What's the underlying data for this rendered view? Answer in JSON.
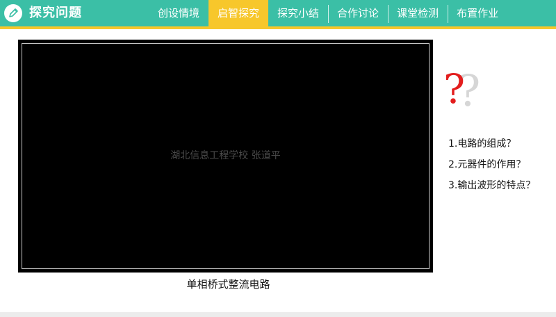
{
  "header": {
    "title": "探究问题",
    "logo_icon": "pencil-icon",
    "bg_color": "#3bbfa6",
    "accent_color": "#f7c72b"
  },
  "nav": {
    "items": [
      {
        "label": "创设情境",
        "active": false
      },
      {
        "label": "启智探究",
        "active": true
      },
      {
        "label": "探究小结",
        "active": false
      },
      {
        "label": "合作讨论",
        "active": false
      },
      {
        "label": "课堂检测",
        "active": false
      },
      {
        "label": "布置作业",
        "active": false
      }
    ]
  },
  "video": {
    "watermark": "湖北信息工程学校  张道平",
    "caption": "单相桥式整流电路"
  },
  "questions": {
    "icon": "question-mark-icon",
    "items": [
      "1.电路的组成？",
      "2.元器件的作用？",
      "3.输出波形的特点？"
    ]
  }
}
